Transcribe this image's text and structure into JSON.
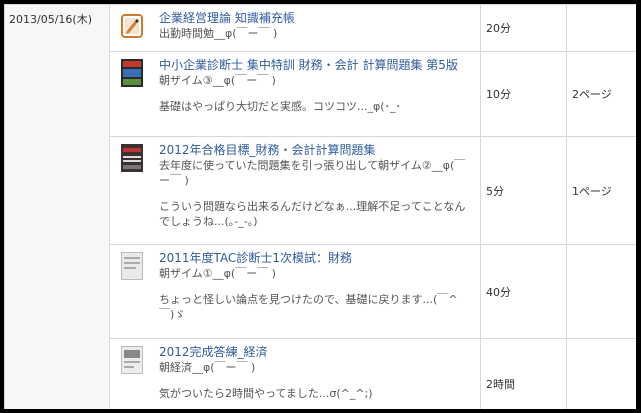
{
  "date": "2013/05/16(木)",
  "entries": [
    {
      "title": "企業経営理論 知識補充帳",
      "sub": "出勤時間勉__φ(￣ー￣ )",
      "comment": "",
      "time": "20分",
      "pages": "",
      "thumb_icon": "pencil-note-icon"
    },
    {
      "title": "中小企業診断士 集中特訓 財務・会計 計算問題集 第5版",
      "sub": "朝ザイム③__φ(￣ー￣ )",
      "comment": "基礎はやっぱり大切だと実感。コツコツ..._φ(･_･",
      "time": "10分",
      "pages": "2ページ",
      "thumb_icon": "book-cover-icon"
    },
    {
      "title": "2012年合格目標_財務・会計計算問題集",
      "sub": "去年度に使っていた問題集を引っ張り出して朝ザイム②__φ(￣ー￣ )",
      "comment": "こういう問題なら出来るんだけどなぁ...理解不足ってことなんでしょうね...(｡-_-｡)",
      "time": "5分",
      "pages": "1ページ",
      "thumb_icon": "book-cover-icon"
    },
    {
      "title": "2011年度TAC診断士1次模試：財務",
      "sub": "朝ザイム①__φ(￣ー￣ )",
      "comment": "ちょっと怪しい論点を見つけたので、基礎に戻ります...(￣^￣)ゞ",
      "time": "40分",
      "pages": "",
      "thumb_icon": "book-cover-icon"
    },
    {
      "title": "2012完成答練_経済",
      "sub": "朝経済__φ(￣ー￣ )",
      "comment": "気がついたら2時間やってました...σ(^_^;)",
      "time": "2時間",
      "pages": "",
      "thumb_icon": "book-cover-icon"
    }
  ]
}
